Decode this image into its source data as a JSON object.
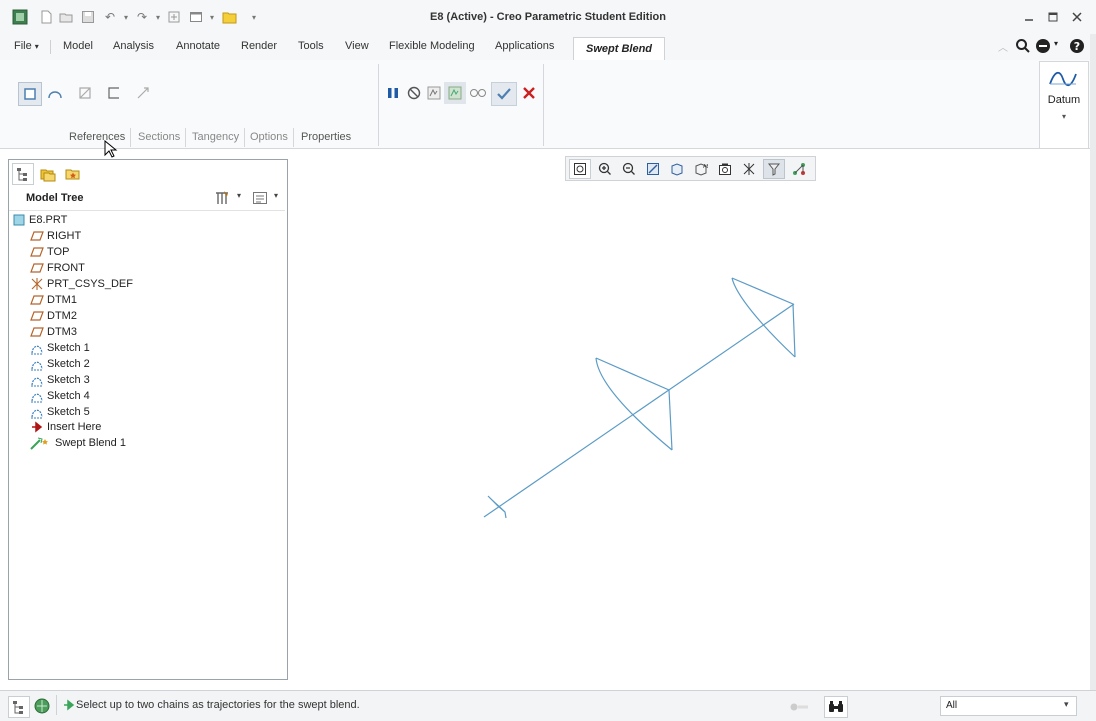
{
  "window": {
    "title": "E8 (Active) - Creo Parametric Student Edition",
    "controls": [
      "minimize-icon",
      "maximize-icon",
      "close-icon"
    ]
  },
  "ribbon_tabs": {
    "file": "File",
    "file_arrow": "▾",
    "items": [
      "Model",
      "Analysis",
      "Annotate",
      "Render",
      "Tools",
      "View",
      "Flexible Modeling",
      "Applications"
    ],
    "active": "Swept Blend"
  },
  "dashboard": {
    "subtabs": [
      "References",
      "Sections",
      "Tangency",
      "Options",
      "Properties"
    ],
    "datum_label": "Datum",
    "datum_arrow": "▾"
  },
  "model_tree": {
    "title": "Model Tree",
    "root": "E8.PRT",
    "items": [
      {
        "label": "RIGHT",
        "icon": "datum-plane-icon"
      },
      {
        "label": "TOP",
        "icon": "datum-plane-icon"
      },
      {
        "label": "FRONT",
        "icon": "datum-plane-icon"
      },
      {
        "label": "PRT_CSYS_DEF",
        "icon": "csys-icon"
      },
      {
        "label": "DTM1",
        "icon": "datum-plane-icon"
      },
      {
        "label": "DTM2",
        "icon": "datum-plane-icon"
      },
      {
        "label": "DTM3",
        "icon": "datum-plane-icon"
      },
      {
        "label": "Sketch 1",
        "icon": "sketch-icon"
      },
      {
        "label": "Sketch 2",
        "icon": "sketch-icon"
      },
      {
        "label": "Sketch 3",
        "icon": "sketch-icon"
      },
      {
        "label": "Sketch 4",
        "icon": "sketch-icon"
      },
      {
        "label": "Sketch 5",
        "icon": "sketch-icon"
      },
      {
        "label": "Insert Here",
        "icon": "insert-arrow-icon"
      },
      {
        "label": "Swept Blend 1",
        "icon": "swept-blend-icon"
      }
    ]
  },
  "status": {
    "message": "Select up to two chains as trajectories for the swept blend.",
    "filter_value": "All",
    "filter_arrow": "▾"
  },
  "colors": {
    "sketch_line": "#5b9bc6",
    "accent_blue": "#1f5aa6",
    "cancel_red": "#cc1f1f",
    "ok_check": "#4d7fb0"
  }
}
